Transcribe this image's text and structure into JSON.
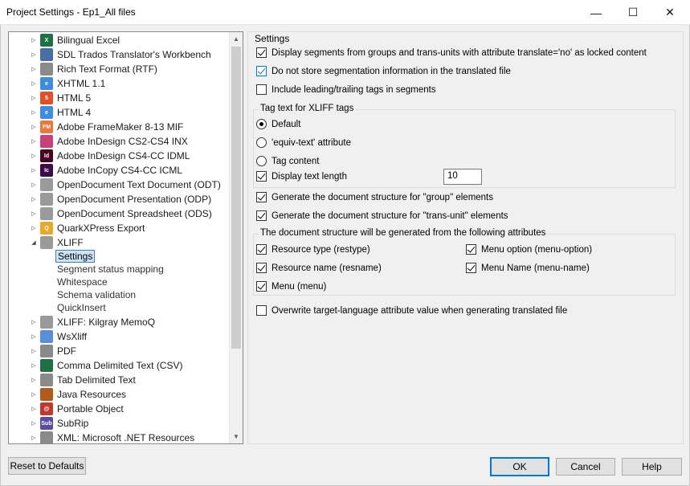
{
  "window": {
    "title": "Project Settings - Ep1_All files",
    "minimize_glyph": "—",
    "maximize_glyph": "☐",
    "close_glyph": "✕"
  },
  "tree": {
    "items": [
      {
        "label": "Bilingual Excel",
        "icon": "excel-icon",
        "color": "#1e7145",
        "glyph": "X"
      },
      {
        "label": "SDL Trados Translator's Workbench",
        "icon": "trados-icon",
        "color": "#4a6fa5",
        "glyph": ""
      },
      {
        "label": "Rich Text Format (RTF)",
        "icon": "rtf-icon",
        "color": "#8a8a8a",
        "glyph": ""
      },
      {
        "label": "XHTML 1.1",
        "icon": "xhtml-icon",
        "color": "#3c8dde",
        "glyph": "e"
      },
      {
        "label": "HTML 5",
        "icon": "html5-icon",
        "color": "#e34f26",
        "glyph": "5"
      },
      {
        "label": "HTML 4",
        "icon": "html4-icon",
        "color": "#3c8dde",
        "glyph": "e"
      },
      {
        "label": "Adobe FrameMaker 8-13 MIF",
        "icon": "framemaker-icon",
        "color": "#e8793a",
        "glyph": "FM"
      },
      {
        "label": "Adobe InDesign CS2-CS4 INX",
        "icon": "indesign-inx-icon",
        "color": "#c8417a",
        "glyph": ""
      },
      {
        "label": "Adobe InDesign CS4-CC IDML",
        "icon": "indesign-idml-icon",
        "color": "#49021f",
        "glyph": "Id"
      },
      {
        "label": "Adobe InCopy CS4-CC ICML",
        "icon": "incopy-icon",
        "color": "#3d0a4a",
        "glyph": "Ic"
      },
      {
        "label": "OpenDocument Text Document (ODT)",
        "icon": "odt-icon",
        "color": "#9a9a9a",
        "glyph": ""
      },
      {
        "label": "OpenDocument Presentation (ODP)",
        "icon": "odp-icon",
        "color": "#9a9a9a",
        "glyph": ""
      },
      {
        "label": "OpenDocument Spreadsheet (ODS)",
        "icon": "ods-icon",
        "color": "#9a9a9a",
        "glyph": ""
      },
      {
        "label": "QuarkXPress Export",
        "icon": "quark-icon",
        "color": "#e8a92a",
        "glyph": "Q"
      },
      {
        "label": "XLIFF",
        "icon": "xliff-icon",
        "color": "#9a9a9a",
        "glyph": ""
      }
    ],
    "xliff_children": [
      "Settings",
      "Segment status mapping",
      "Whitespace",
      "Schema validation",
      "QuickInsert"
    ],
    "items_after": [
      {
        "label": "XLIFF: Kilgray MemoQ",
        "icon": "memoq-icon",
        "color": "#9a9a9a",
        "glyph": ""
      },
      {
        "label": "WsXliff",
        "icon": "wsxliff-icon",
        "color": "#5b8ed8",
        "glyph": ""
      },
      {
        "label": "PDF",
        "icon": "pdf-icon",
        "color": "#8a8a8a",
        "glyph": ""
      },
      {
        "label": "Comma Delimited Text (CSV)",
        "icon": "csv-icon",
        "color": "#1e7145",
        "glyph": ""
      },
      {
        "label": "Tab Delimited Text",
        "icon": "tab-text-icon",
        "color": "#8a8a8a",
        "glyph": ""
      },
      {
        "label": "Java Resources",
        "icon": "java-icon",
        "color": "#b05a1c",
        "glyph": ""
      },
      {
        "label": "Portable Object",
        "icon": "po-icon",
        "color": "#c0392b",
        "glyph": "@"
      },
      {
        "label": "SubRip",
        "icon": "subrip-icon",
        "color": "#5a4ba8",
        "glyph": "Sub"
      },
      {
        "label": "XML: Microsoft .NET Resources",
        "icon": "xml-icon",
        "color": "#8a8a8a",
        "glyph": ""
      }
    ],
    "expander_glyph": "▷",
    "expanded_glyph": "◢",
    "scroll_up_glyph": "▲",
    "scroll_down_glyph": "▼"
  },
  "panel": {
    "title": "Settings",
    "opt_locked": "Display segments from groups and trans-units with attribute translate='no' as locked content",
    "opt_nostore": "Do not store segmentation information in the translated file",
    "opt_include_tags": "Include leading/trailing tags in segments",
    "tag_group_label": "Tag text for XLIFF tags",
    "radio_default": "Default",
    "radio_equiv": "'equiv-text' attribute",
    "radio_tag_content": "Tag content",
    "opt_display_length": "Display text length",
    "display_length_value": "10",
    "opt_group_structure": "Generate the document structure for \"group\" elements",
    "opt_transunit_structure": "Generate the document structure for \"trans-unit\" elements",
    "attr_group_label": "The document structure will be generated from the following attributes",
    "attr_restype": "Resource type (restype)",
    "attr_resname": "Resource name (resname)",
    "attr_menu": "Menu (menu)",
    "attr_menu_option": "Menu option (menu-option)",
    "attr_menu_name": "Menu Name (menu-name)",
    "opt_overwrite": "Overwrite target-language attribute value when generating translated file"
  },
  "buttons": {
    "reset": "Reset to Defaults",
    "ok": "OK",
    "cancel": "Cancel",
    "help": "Help"
  }
}
